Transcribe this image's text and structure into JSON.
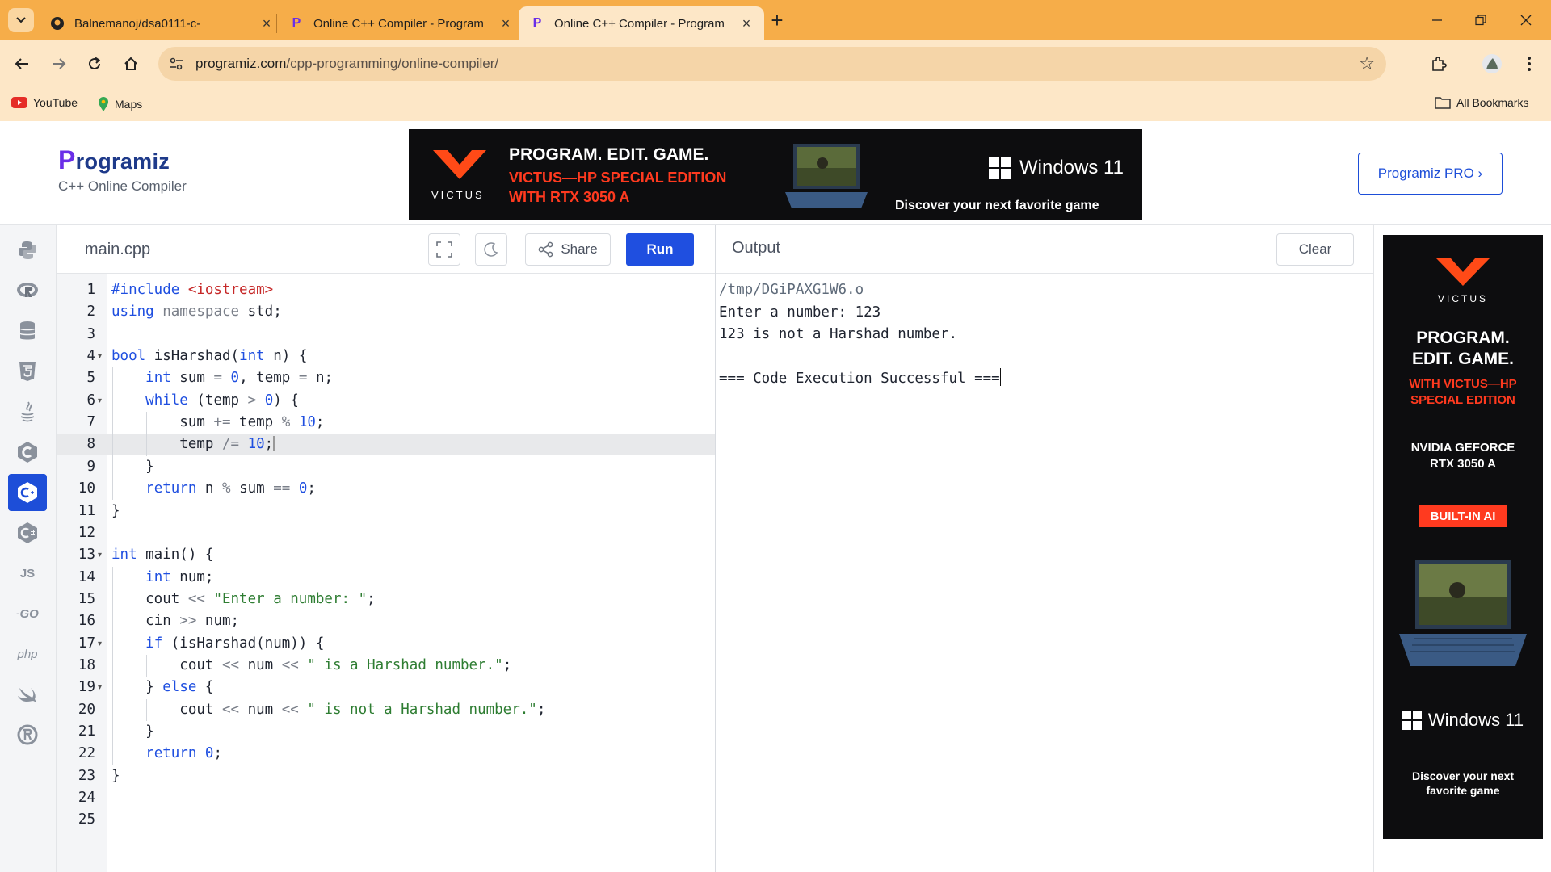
{
  "browser": {
    "tabs": [
      {
        "title": "Balnemanoj/dsa0111-c-",
        "favicon": "github-icon",
        "active": false
      },
      {
        "title": "Online C++ Compiler - Program",
        "favicon": "programiz-icon",
        "active": false
      },
      {
        "title": "Online C++ Compiler - Program",
        "favicon": "programiz-icon",
        "active": true
      }
    ],
    "url_host": "programiz.com",
    "url_path": "/cpp-programming/online-compiler/",
    "bookmarks": [
      {
        "label": "YouTube",
        "icon": "youtube-icon"
      },
      {
        "label": "Maps",
        "icon": "maps-icon"
      }
    ],
    "all_bookmarks": "All Bookmarks"
  },
  "header": {
    "logo_initial": "P",
    "logo_rest": "rogramiz",
    "subtitle": "C++ Online Compiler",
    "pro_button": "Programiz PRO ›"
  },
  "banner": {
    "brand": "VICTUS",
    "line1": "PROGRAM. EDIT. GAME.",
    "line2": "VICTUS—HP SPECIAL EDITION",
    "line3": "WITH RTX 3050 A",
    "windows": "Windows 11",
    "tagline": "Discover your next favorite game"
  },
  "side_ad": {
    "brand": "VICTUS",
    "line1": "PROGRAM.",
    "line2": "EDIT. GAME.",
    "line3": "WITH VICTUS—HP",
    "line4": "SPECIAL EDITION",
    "line5": "NVIDIA GEFORCE",
    "line6": "RTX 3050 A",
    "badge": "BUILT-IN AI",
    "windows": "Windows 11",
    "tagline1": "Discover your next",
    "tagline2": "favorite game"
  },
  "languages": [
    {
      "name": "python-icon",
      "label": ""
    },
    {
      "name": "r-icon",
      "label": ""
    },
    {
      "name": "sql-icon",
      "label": ""
    },
    {
      "name": "html-icon",
      "label": ""
    },
    {
      "name": "java-icon",
      "label": ""
    },
    {
      "name": "c-icon",
      "label": ""
    },
    {
      "name": "cpp-icon",
      "label": "",
      "active": true
    },
    {
      "name": "csharp-icon",
      "label": ""
    },
    {
      "name": "js-icon",
      "label": "JS"
    },
    {
      "name": "go-icon",
      "label": "GO"
    },
    {
      "name": "php-icon",
      "label": "php"
    },
    {
      "name": "swift-icon",
      "label": ""
    },
    {
      "name": "rust-icon",
      "label": ""
    }
  ],
  "editor": {
    "filename": "main.cpp",
    "share_label": "Share",
    "run_label": "Run",
    "active_line": 8,
    "lines": [
      "#include <iostream>",
      "using namespace std;",
      "",
      "bool isHarshad(int n) {",
      "    int sum = 0, temp = n;",
      "    while (temp > 0) {",
      "        sum += temp % 10;",
      "        temp /= 10;",
      "    }",
      "    return n % sum == 0;",
      "}",
      "",
      "int main() {",
      "    int num;",
      "    cout << \"Enter a number: \";",
      "    cin >> num;",
      "    if (isHarshad(num)) {",
      "        cout << num << \" is a Harshad number.\";",
      "    } else {",
      "        cout << num << \" is not a Harshad number.\";",
      "    }",
      "    return 0;",
      "}",
      "",
      ""
    ],
    "fold_lines": [
      4,
      6,
      13,
      17,
      19
    ]
  },
  "output": {
    "title": "Output",
    "clear_label": "Clear",
    "lines": [
      "/tmp/DGiPAXG1W6.o",
      "Enter a number: 123",
      "123 is not a Harshad number.",
      "",
      "=== Code Execution Successful ==="
    ]
  }
}
